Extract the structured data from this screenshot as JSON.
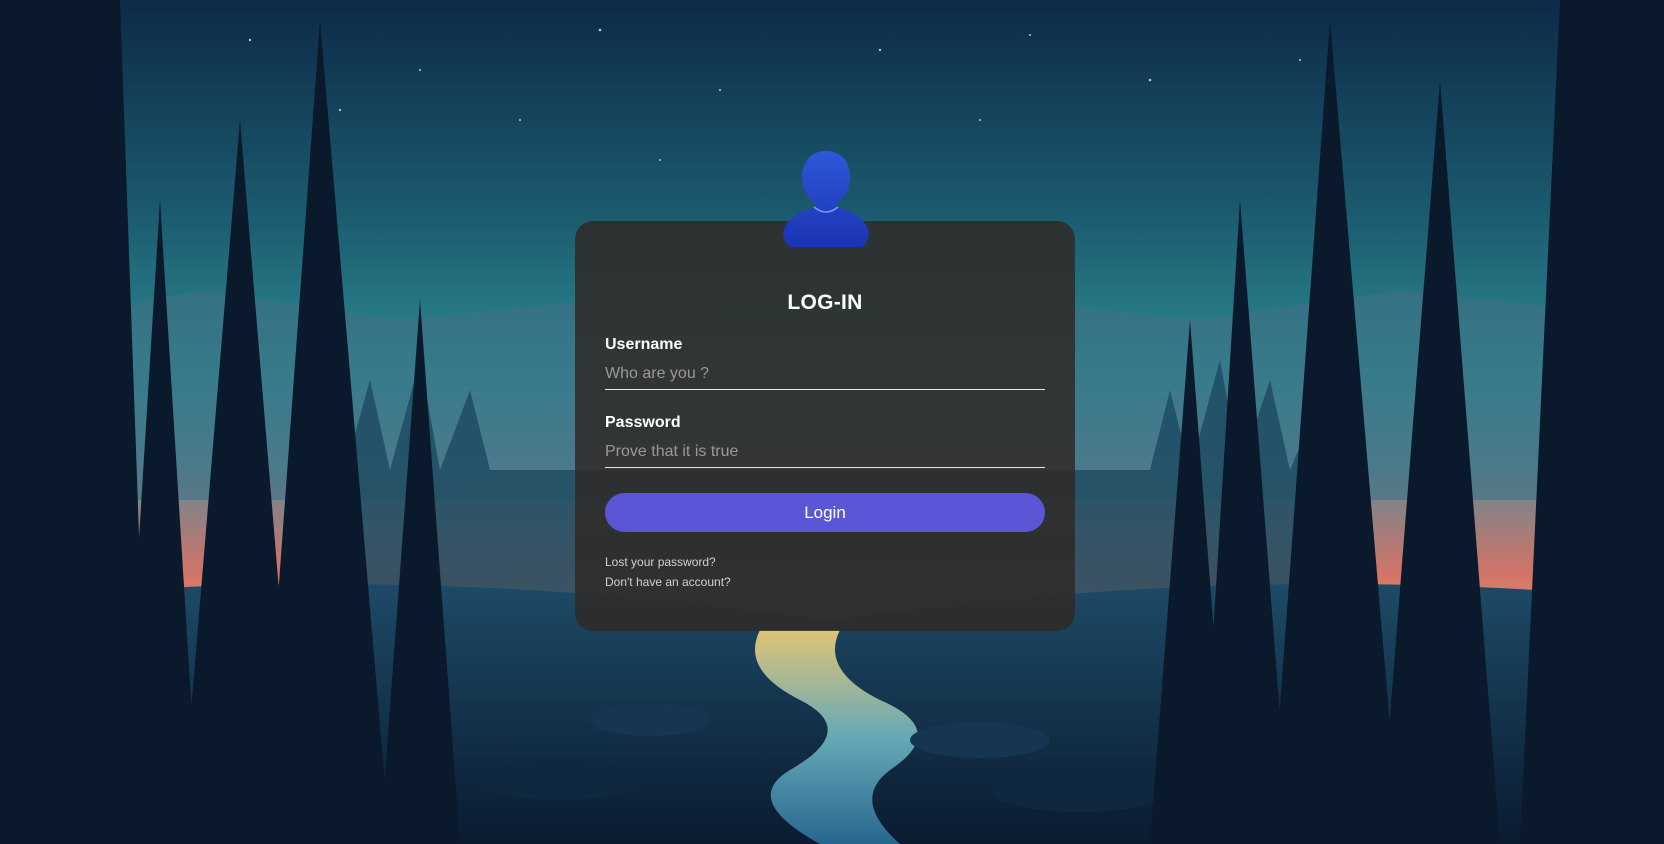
{
  "login": {
    "title": "LOG-IN",
    "username_label": "Username",
    "username_placeholder": "Who are you ?",
    "username_value": "",
    "password_label": "Password",
    "password_placeholder": "Prove that it is true",
    "password_value": "",
    "submit_label": "Login",
    "lost_password_link": "Lost your password?",
    "no_account_link": "Don't have an account?"
  },
  "icons": {
    "avatar": "user-avatar-icon"
  },
  "colors": {
    "card_background": "#302a28",
    "button": "#5a57d6",
    "avatar": "#1e3fc4",
    "text": "#ffffff"
  }
}
